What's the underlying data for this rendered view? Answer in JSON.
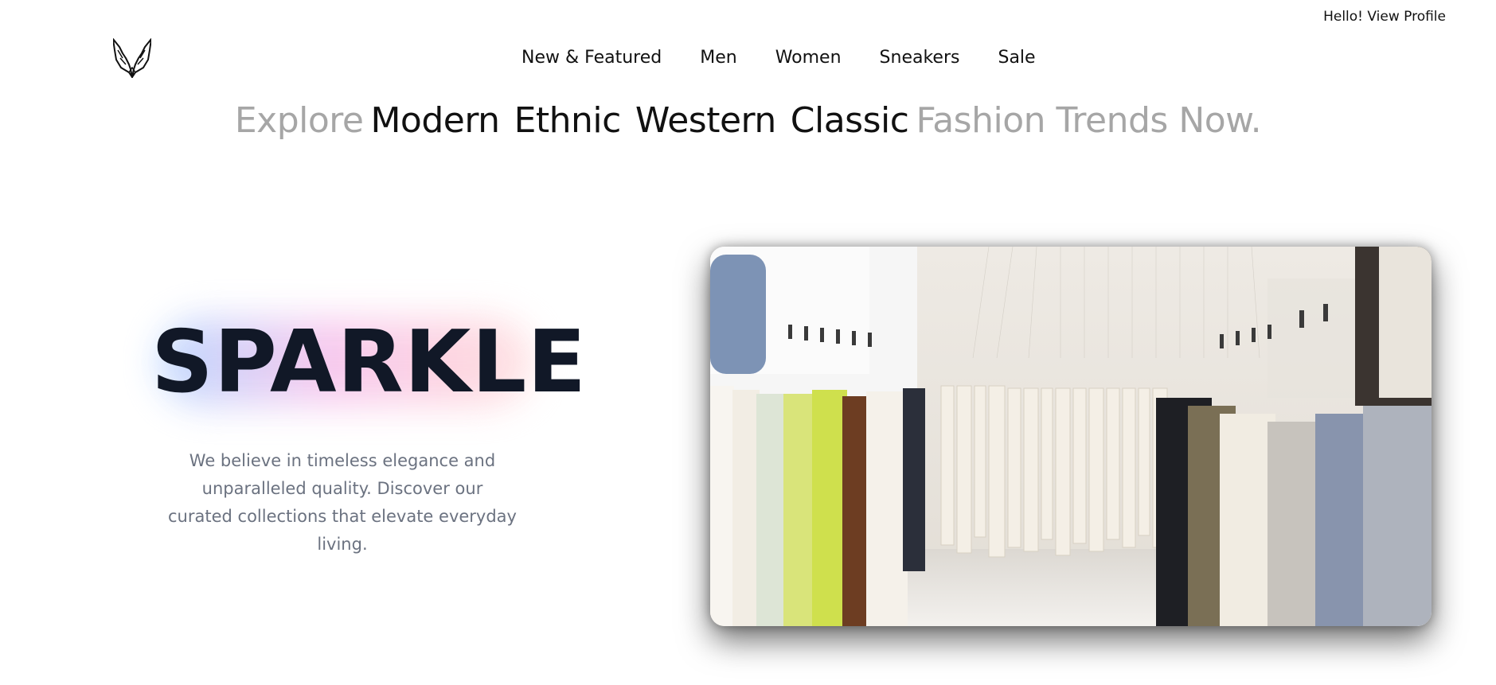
{
  "header": {
    "profile_link": "Hello! View Profile",
    "logo_icon": "wings-logo-icon"
  },
  "nav": {
    "items": [
      {
        "label": "New & Featured"
      },
      {
        "label": "Men"
      },
      {
        "label": "Women"
      },
      {
        "label": "Sneakers"
      },
      {
        "label": "Sale"
      }
    ]
  },
  "headline": {
    "prefix": "Explore",
    "styles": [
      "Modern",
      "Ethnic",
      "Western",
      "Classic"
    ],
    "suffix": "Fashion Trends Now."
  },
  "hero": {
    "title": "SPARKLE",
    "tagline": "We believe in timeless elegance and unparalleled quality. Discover our curated collections that elevate everyday living.",
    "image_subject": "clothing-store-racks-photo"
  },
  "colors": {
    "muted_text": "#a6a6a6",
    "title_text": "#111827",
    "tagline_text": "#6b7280",
    "glow_blue": "#bcd8ff",
    "glow_pink": "#f7c8ee"
  }
}
